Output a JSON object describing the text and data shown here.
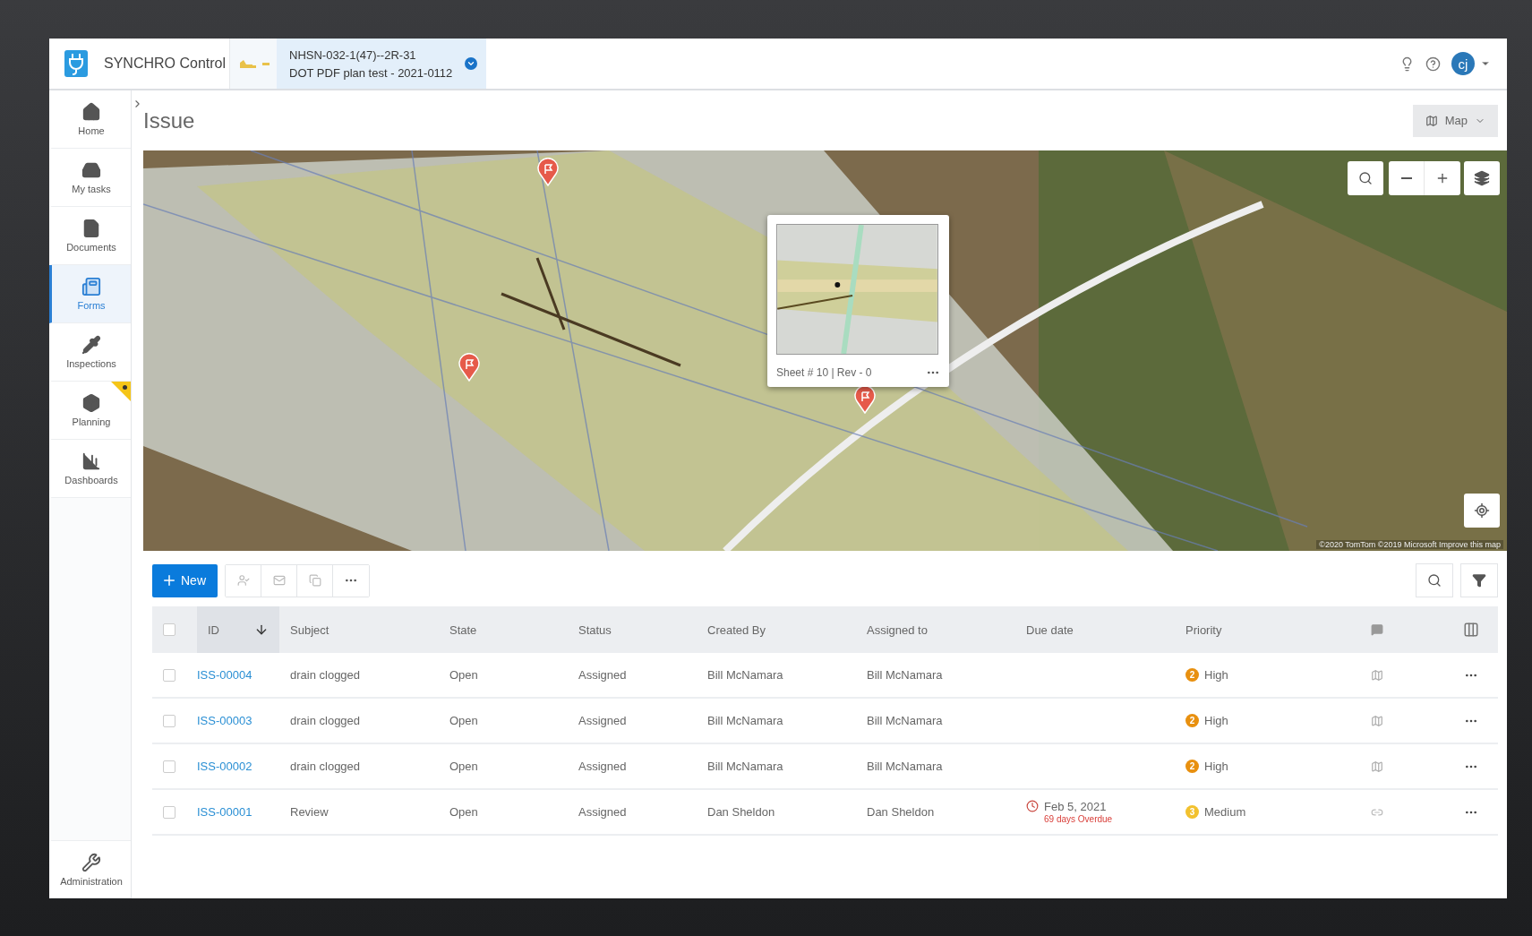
{
  "header": {
    "app_name": "SYNCHRO Control",
    "project": {
      "code": "NHSN-032-1(47)--2R-31",
      "name": "DOT PDF plan test - 2021-0112"
    },
    "avatar": "cj"
  },
  "sidebar": {
    "items": [
      {
        "label": "Home",
        "selected": false,
        "flagged": false
      },
      {
        "label": "My tasks",
        "selected": false,
        "flagged": false
      },
      {
        "label": "Documents",
        "selected": false,
        "flagged": false
      },
      {
        "label": "Forms",
        "selected": true,
        "flagged": false
      },
      {
        "label": "Inspections",
        "selected": false,
        "flagged": false
      },
      {
        "label": "Planning",
        "selected": false,
        "flagged": true
      },
      {
        "label": "Dashboards",
        "selected": false,
        "flagged": false
      }
    ],
    "bottom_item": {
      "label": "Administration",
      "selected": false
    }
  },
  "page": {
    "title": "Issue",
    "view_button": "Map"
  },
  "map": {
    "popup": {
      "caption": "Sheet # 10 | Rev - 0"
    },
    "attribution": "©2020 TomTom ©2019 Microsoft Improve this map"
  },
  "toolbar": {
    "new_button": "New"
  },
  "table": {
    "header_checked": false,
    "columns": [
      "ID",
      "Subject",
      "State",
      "Status",
      "Created By",
      "Assigned to",
      "Due date",
      "Priority"
    ],
    "rows": [
      {
        "checked": false,
        "id": "ISS-00004",
        "subject": "drain clogged",
        "state": "Open",
        "status": "Assigned",
        "created_by": "Bill McNamara",
        "assigned_to": "Bill McNamara",
        "priority": {
          "number": "2",
          "label": "High",
          "color": "#e8900f"
        },
        "kind": "map"
      },
      {
        "checked": false,
        "id": "ISS-00003",
        "subject": "drain clogged",
        "state": "Open",
        "status": "Assigned",
        "created_by": "Bill McNamara",
        "assigned_to": "Bill McNamara",
        "priority": {
          "number": "2",
          "label": "High",
          "color": "#e8900f"
        },
        "kind": "map"
      },
      {
        "checked": false,
        "id": "ISS-00002",
        "subject": "drain clogged",
        "state": "Open",
        "status": "Assigned",
        "created_by": "Bill McNamara",
        "assigned_to": "Bill McNamara",
        "priority": {
          "number": "2",
          "label": "High",
          "color": "#e8900f"
        },
        "kind": "map"
      },
      {
        "checked": false,
        "id": "ISS-00001",
        "subject": "Review",
        "state": "Open",
        "status": "Assigned",
        "created_by": "Dan Sheldon",
        "assigned_to": "Dan Sheldon",
        "due_date": {
          "date": "Feb 5, 2021",
          "overdue": "69 days Overdue"
        },
        "priority": {
          "number": "3",
          "label": "Medium",
          "color": "#f2c12e"
        },
        "kind": "link"
      }
    ]
  }
}
